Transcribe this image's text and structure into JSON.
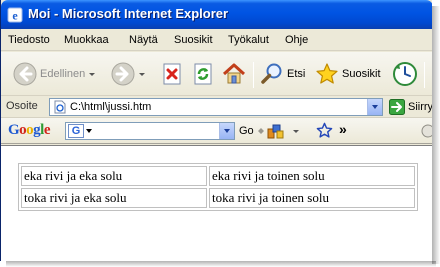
{
  "window": {
    "title": "Moi - Microsoft Internet Explorer"
  },
  "menu": [
    "Tiedosto",
    "Muokkaa",
    "Näytä",
    "Suosikit",
    "Työkalut",
    "Ohje"
  ],
  "toolbar": {
    "back_label": "Edellinen",
    "search_label": "Etsi",
    "favorites_label": "Suosikit"
  },
  "address": {
    "label": "Osoite",
    "url": "C:\\html\\jussi.htm",
    "go_label": "Siirry"
  },
  "google": {
    "logo": "Google",
    "go_label": "Go",
    "more": "»"
  },
  "page": {
    "table": [
      [
        "eka rivi ja eka solu",
        "eka rivi ja toinen solu"
      ],
      [
        "toka rivi ja eka solu",
        "toka rivi ja toinen solu"
      ]
    ]
  },
  "colors": {
    "titlebar": "#0054e3",
    "chrome": "#ece9d8",
    "google_blue": "#2a63d8"
  }
}
